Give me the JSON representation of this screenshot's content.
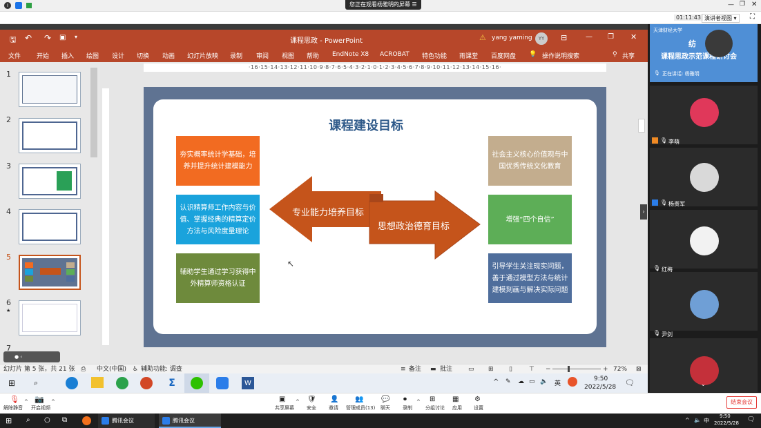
{
  "share_banner": "您正在观看杨雅明的屏幕",
  "meeting": {
    "timer": "01:11:43",
    "speaker_view": "演讲者视图"
  },
  "ppt": {
    "window_title": "课程思政 - PowerPoint",
    "user": "yang yaming",
    "user_initials": "YY",
    "ribbon_tabs": [
      "文件",
      "开始",
      "插入",
      "绘图",
      "设计",
      "切换",
      "动画",
      "幻灯片放映",
      "录制",
      "审阅",
      "视图",
      "帮助",
      "EndNote X8",
      "ACROBAT",
      "特色功能",
      "雨课堂",
      "百度网盘"
    ],
    "tell_me": "操作说明搜索",
    "share": "共享",
    "ruler": "·16·15·14·13·12·11·10·9·8·7·6·5·4·3·2·1·0·1·2·3·4·5·6·7·8·9·10·11·12·13·14·15·16·",
    "thumbnails": [
      "1",
      "2",
      "3",
      "4",
      "5",
      "6",
      "7"
    ]
  },
  "slide": {
    "title": "课程建设目标",
    "left_boxes": [
      "夯实概率统计学基础，培养并提升统计建模能力",
      "认识精算师工作内容与价值、掌握经典的精算定价方法与风险度量理论",
      "辅助学生通过学习获得中外精算师资格认证"
    ],
    "right_boxes": [
      "社会主义核心价值观与中国优秀传统文化教育",
      "增强“四个自信”",
      "引导学生关注现实问题，善于通过模型方法与统计建模刻画与解决实际问题"
    ],
    "left_arrow": "专业能力培养目标",
    "right_arrow": "思想政治德育目标",
    "colors": {
      "left": [
        "#f26b21",
        "#1aa3dc",
        "#6e8a3c"
      ],
      "right": [
        "#c3ad8e",
        "#5dae57",
        "#4f6e9c"
      ],
      "arrow": "#c5541b",
      "frame": "#5f7392"
    }
  },
  "status": {
    "slide_info": "幻灯片 第 5 张，共 21 张",
    "language": "中文(中国)",
    "accessibility": "辅助功能: 调查",
    "notes": "备注",
    "comments": "批注",
    "zoom": "72%"
  },
  "inner_taskbar": {
    "time": "9:50",
    "date": "2022/5/28"
  },
  "participants": {
    "banner_org": "天津财经大学",
    "banner_title": "课程思政示范课程研讨会",
    "banner_sub": "纺",
    "speaking": "正在讲话: 杨雅明",
    "names": [
      "李萌",
      "杨贵军",
      "红梅",
      "尹剑"
    ]
  },
  "bottombar": {
    "buttons": [
      "解除静音",
      "开启视频",
      "共享屏幕",
      "安全",
      "邀请",
      "管理成员(13)",
      "聊天",
      "录制",
      "分组讨论",
      "应用",
      "设置"
    ],
    "end": "结束会议"
  },
  "windows_taskbar": {
    "apps": [
      "腾讯会议",
      "腾讯会议"
    ],
    "ime": "中",
    "time": "9:50",
    "date": "2022/5/28"
  }
}
